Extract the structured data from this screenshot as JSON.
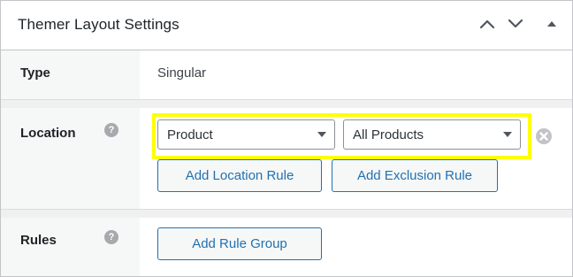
{
  "panel": {
    "title": "Themer Layout Settings",
    "controls": [
      "collapse-up-icon",
      "collapse-down-icon",
      "toggle-triangle-icon"
    ]
  },
  "rows": {
    "type": {
      "label": "Type",
      "value": "Singular"
    },
    "location": {
      "label": "Location",
      "help_icon": "?",
      "select_primary": "Product",
      "select_secondary": "All Products",
      "add_location_rule": "Add Location Rule",
      "add_exclusion_rule": "Add Exclusion Rule",
      "highlight_color": "#ffff00"
    },
    "rules": {
      "label": "Rules",
      "help_icon": "?",
      "add_rule_group": "Add Rule Group"
    }
  },
  "colors": {
    "accent": "#2271b1",
    "label_bg": "#f6f7f7",
    "separator": "#f0f0f1"
  }
}
